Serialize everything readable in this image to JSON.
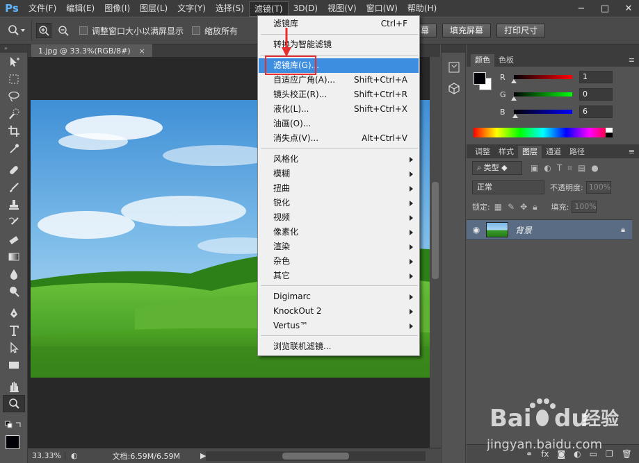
{
  "app": {
    "logo": "Ps"
  },
  "menubar": {
    "items": [
      "文件(F)",
      "编辑(E)",
      "图像(I)",
      "图层(L)",
      "文字(Y)",
      "选择(S)",
      "滤镜(T)",
      "3D(D)",
      "视图(V)",
      "窗口(W)",
      "帮助(H)"
    ],
    "active_index": 6
  },
  "window_controls": {
    "minimize": "−",
    "maximize": "□",
    "close": "✕"
  },
  "options_bar": {
    "check_resize": "调整窗口大小以满屏显示",
    "check_zoom_all": "缩放所有",
    "btn_fit": "合屏幕",
    "btn_fill": "填充屏幕",
    "btn_print": "打印尺寸"
  },
  "document": {
    "tab_title": "1.jpg @ 33.3%(RGB/8#)",
    "tab_close": "×"
  },
  "status": {
    "zoom": "33.33%",
    "doc_size": "文档:6.59M/6.59M"
  },
  "filter_menu": {
    "groups": [
      [
        {
          "label": "滤镜库",
          "shortcut": "Ctrl+F"
        }
      ],
      [
        {
          "label": "转换为智能滤镜",
          "shortcut": ""
        }
      ],
      [
        {
          "label": "滤镜库(G)...",
          "shortcut": "",
          "highlighted": true
        },
        {
          "label": "自适应广角(A)...",
          "shortcut": "Shift+Ctrl+A"
        },
        {
          "label": "镜头校正(R)...",
          "shortcut": "Shift+Ctrl+R"
        },
        {
          "label": "液化(L)...",
          "shortcut": "Shift+Ctrl+X"
        },
        {
          "label": "油画(O)...",
          "shortcut": ""
        },
        {
          "label": "消失点(V)...",
          "shortcut": "Alt+Ctrl+V"
        }
      ],
      [
        {
          "label": "风格化",
          "submenu": true
        },
        {
          "label": "模糊",
          "submenu": true
        },
        {
          "label": "扭曲",
          "submenu": true
        },
        {
          "label": "锐化",
          "submenu": true
        },
        {
          "label": "视频",
          "submenu": true
        },
        {
          "label": "像素化",
          "submenu": true
        },
        {
          "label": "渲染",
          "submenu": true
        },
        {
          "label": "杂色",
          "submenu": true
        },
        {
          "label": "其它",
          "submenu": true
        }
      ],
      [
        {
          "label": "Digimarc",
          "submenu": true
        },
        {
          "label": "KnockOut 2",
          "submenu": true
        },
        {
          "label": "Vertus™",
          "submenu": true
        }
      ],
      [
        {
          "label": "浏览联机滤镜...",
          "shortcut": ""
        }
      ]
    ]
  },
  "color_panel": {
    "tabs": [
      "颜色",
      "色板"
    ],
    "active_tab": 0,
    "r_label": "R",
    "g_label": "G",
    "b_label": "B",
    "r": "1",
    "g": "0",
    "b": "6",
    "r_fraction": 0.004,
    "g_fraction": 0.0,
    "b_fraction": 0.024,
    "foreground_color": "#010006",
    "background_color": "#ffffff"
  },
  "layers_panel": {
    "tabs": [
      "调整",
      "样式",
      "图层",
      "通道",
      "路径"
    ],
    "active_tab": 2,
    "filter_kind": "类型",
    "blend_mode": "正常",
    "opacity_label": "不透明度:",
    "opacity": "100%",
    "lock_label": "锁定:",
    "fill_label": "填充:",
    "fill": "100%",
    "layers": [
      {
        "name": "背景",
        "visible": true,
        "locked": true
      }
    ],
    "footer_icons": [
      "link-icon",
      "fx-icon",
      "mask-icon",
      "adjustment-icon",
      "folder-icon",
      "new-layer-icon",
      "trash-icon"
    ]
  },
  "watermark": {
    "brand": "Baidu",
    "brand_cn": "经验",
    "url": "jingyan.baidu.com"
  },
  "colors": {
    "menu_highlight": "#3d8ee0",
    "annotation_red": "#e62e2e",
    "layer_selected": "#596c84",
    "ps_blue": "#5fb6ff"
  }
}
